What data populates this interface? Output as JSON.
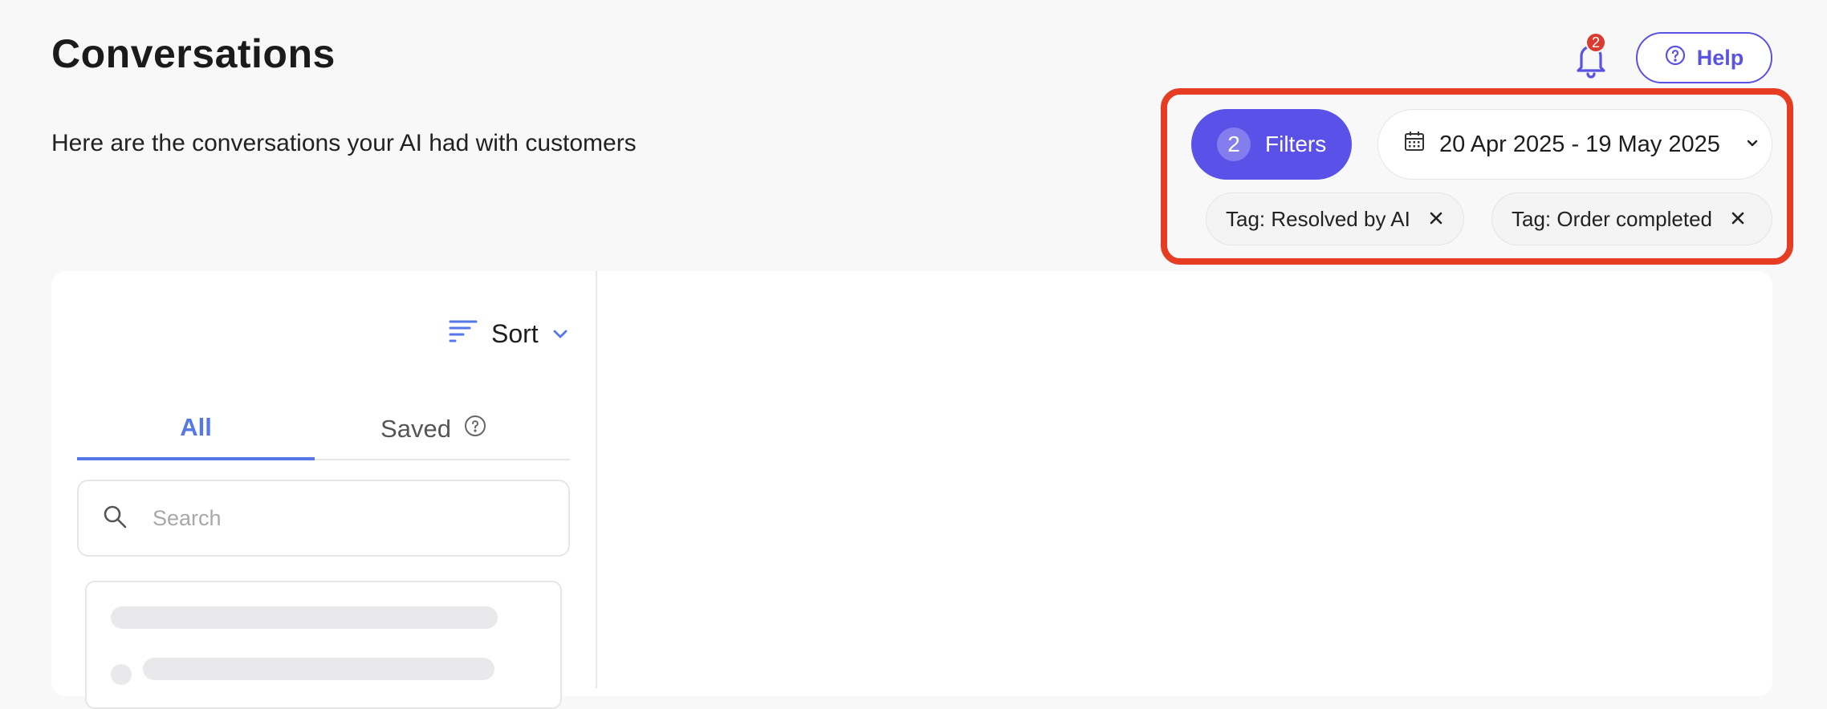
{
  "header": {
    "title": "Conversations",
    "subtitle": "Here are the conversations your AI had with customers",
    "notifications_count": "2",
    "help_label": "Help"
  },
  "filters": {
    "count": "2",
    "label": "Filters",
    "date_range": "20 Apr 2025 - 19 May 2025",
    "tags": [
      {
        "label": "Tag: Resolved by AI"
      },
      {
        "label": "Tag: Order completed"
      }
    ]
  },
  "list": {
    "sort_label": "Sort",
    "tabs": [
      {
        "label": "All",
        "active": true
      },
      {
        "label": "Saved",
        "active": false
      }
    ],
    "search_placeholder": "Search"
  },
  "colors": {
    "accent": "#5a52e8",
    "tab_active": "#5577e8",
    "highlight": "#e53c23",
    "badge": "#d93b2f"
  },
  "icons": [
    "bell-icon",
    "help-circle-icon",
    "calendar-icon",
    "chevron-down-icon",
    "close-icon",
    "sort-lines-icon",
    "question-circle-icon",
    "search-icon"
  ]
}
